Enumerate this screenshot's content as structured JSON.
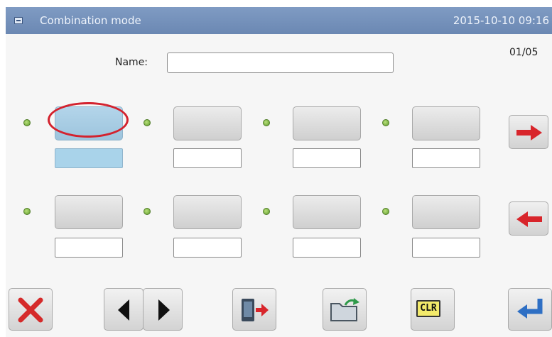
{
  "titlebar": {
    "title": "Combination mode",
    "datetime": "2015-10-10 09:16"
  },
  "form": {
    "name_label": "Name:",
    "name_value": ""
  },
  "page_indicator": "01/05",
  "slots": [
    {
      "index": 1,
      "value": "",
      "selected": true
    },
    {
      "index": 2,
      "value": "",
      "selected": false
    },
    {
      "index": 3,
      "value": "",
      "selected": false
    },
    {
      "index": 4,
      "value": "",
      "selected": false
    },
    {
      "index": 5,
      "value": "",
      "selected": false
    },
    {
      "index": 6,
      "value": "",
      "selected": false
    },
    {
      "index": 7,
      "value": "",
      "selected": false
    },
    {
      "index": 8,
      "value": "",
      "selected": false
    }
  ],
  "buttons": {
    "next_page": "arrow-right-icon",
    "prev_page": "arrow-left-icon",
    "delete": "x-icon",
    "move_left": "triangle-left-icon",
    "move_right": "triangle-right-icon",
    "export": "export-icon",
    "open_folder": "folder-icon",
    "clear": "CLR",
    "enter": "enter-icon"
  },
  "colors": {
    "titlebar": "#6b88b3",
    "selection_ring": "#d3222e",
    "selected_slot": "#a9d3ea",
    "indicator_dot": "#6ea336"
  }
}
